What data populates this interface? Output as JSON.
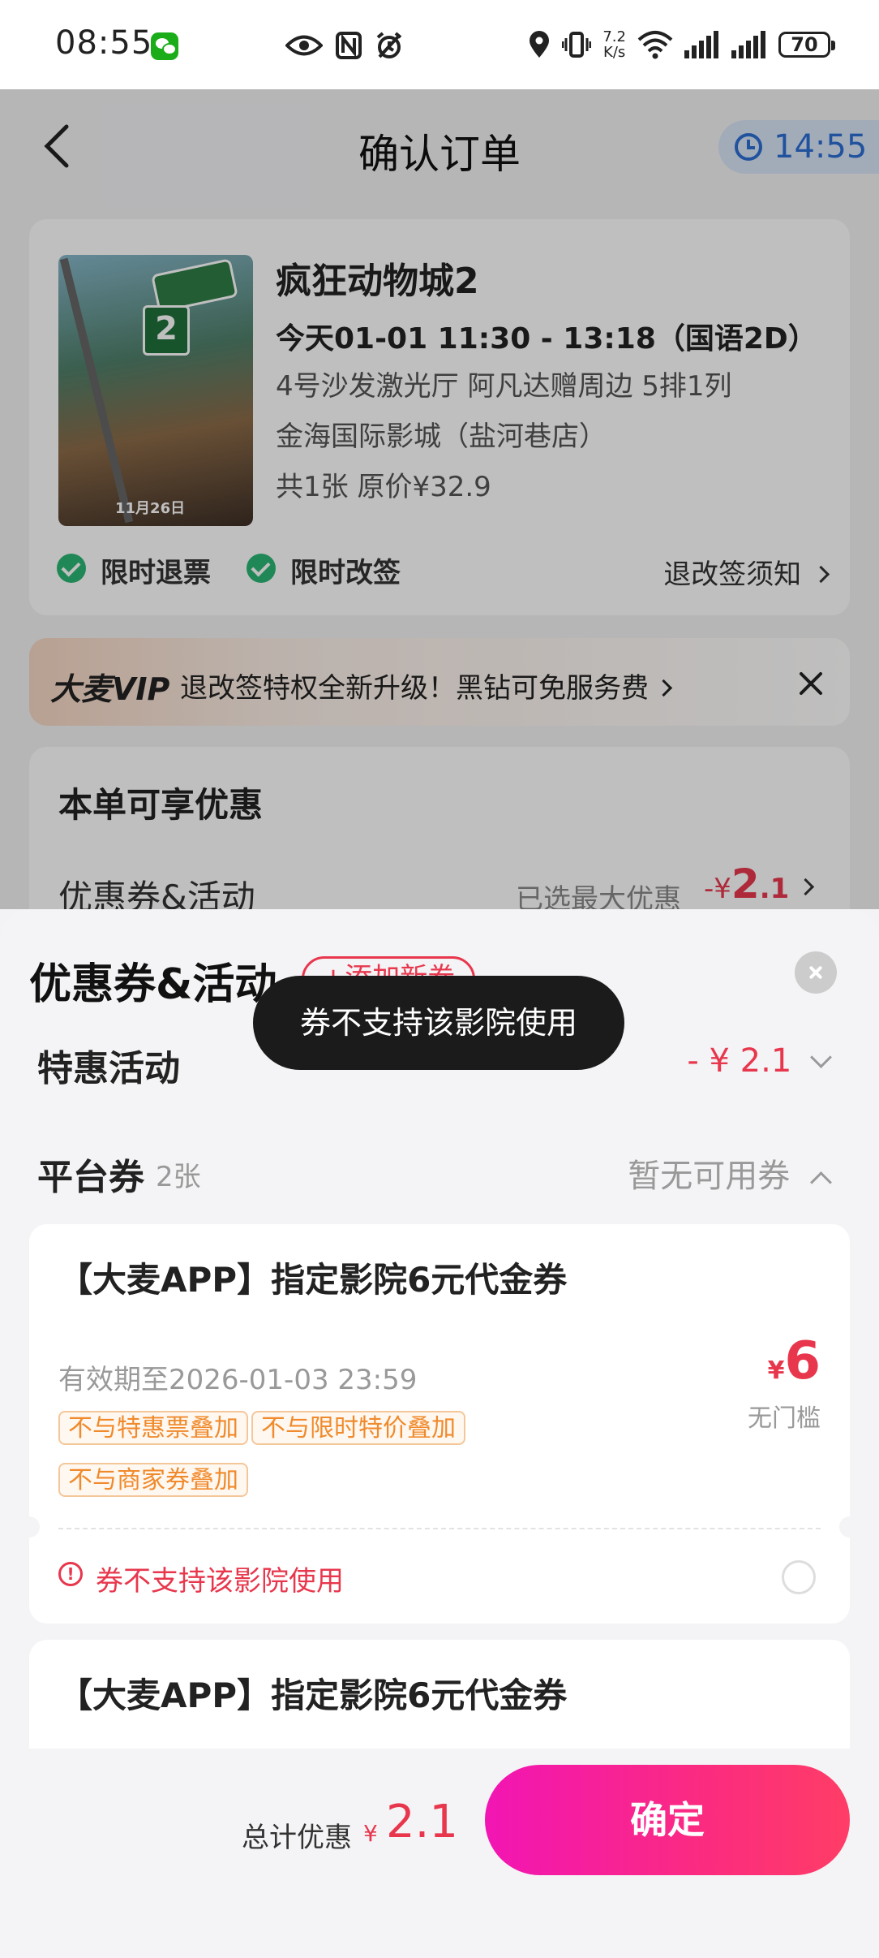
{
  "status_bar": {
    "time": "08:55",
    "net_speed_value": "7.2",
    "net_speed_unit": "K/s",
    "battery": "70"
  },
  "nav": {
    "title": "确认订单",
    "countdown": "14:55"
  },
  "order": {
    "movie_title": "疯狂动物城2",
    "showtime": "今天01-01 11:30 - 13:18（国语2D）",
    "hall_seat": "4号沙发激光厅  阿凡达赠周边 5排1列",
    "cinema": "金海国际影城（盐河巷店）",
    "price_info": "共1张 原价¥32.9",
    "poster_date": "11月26日",
    "tag_refund": "限时退票",
    "tag_change": "限时改签",
    "notice_link": "退改签须知"
  },
  "vip": {
    "logo": "大麦VIP",
    "text": "退改签特权全新升级！黑钻可免服务费"
  },
  "discount": {
    "title": "本单可享优惠",
    "row_label": "优惠券&活动",
    "selected_text": "已选最大优惠",
    "amount_prefix": "-¥",
    "amount_int": "2",
    "amount_dec": ".1"
  },
  "sheet": {
    "title": "优惠券&活动",
    "add_button": "+添加新券",
    "toast": "券不支持该影院使用",
    "special": {
      "label": "特惠活动",
      "value": "- ¥ 2.1"
    },
    "platform": {
      "label": "平台券",
      "count": "2张",
      "status": "暂无可用券"
    },
    "coupons": [
      {
        "title": "【大麦APP】指定影院6元代金券",
        "validity": "有效期至2026-01-03 23:59",
        "tags": [
          "不与特惠票叠加",
          "不与限时特价叠加",
          "不与商家券叠加"
        ],
        "currency": "¥",
        "amount": "6",
        "threshold": "无门槛",
        "warning": "券不支持该影院使用"
      },
      {
        "title": "【大麦APP】指定影院6元代金券"
      }
    ]
  },
  "footer": {
    "total_label": "总计优惠",
    "currency": "¥",
    "total_value": "2.1",
    "confirm": "确定"
  },
  "colors": {
    "accent_red": "#e8374d",
    "confirm_gradient_start": "#f215b4",
    "confirm_gradient_end": "#ff3d66",
    "success_green": "#2bb673",
    "timer_blue": "#2d6ed3"
  }
}
